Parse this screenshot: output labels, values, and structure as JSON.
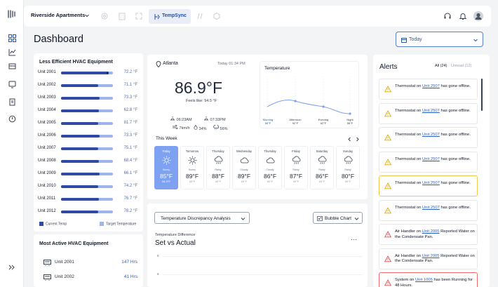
{
  "topbar": {
    "property": "Riverside Apartments",
    "active_tab": "TempSync"
  },
  "page": {
    "title": "Dashboard",
    "date_filter": "Today"
  },
  "less_efficient": {
    "title": "Less Efficient HVAC Equipment",
    "rows": [
      {
        "unit": "Unit 2001",
        "value": "72.2 °F",
        "progress": 0.92
      },
      {
        "unit": "Unit 2002",
        "value": "71.1 °F",
        "progress": 0.72
      },
      {
        "unit": "Unit 2003",
        "value": "73.3 °F",
        "progress": 0.74
      },
      {
        "unit": "Unit 2004",
        "value": "62.8 °F",
        "progress": 0.73
      },
      {
        "unit": "Unit 2005",
        "value": "81.7 °F",
        "progress": 0.72
      },
      {
        "unit": "Unit 2006",
        "value": "73.3 °F",
        "progress": 0.74
      },
      {
        "unit": "Unit 2007",
        "value": "75.1 °F",
        "progress": 0.72
      },
      {
        "unit": "Unit 2008",
        "value": "68.4 °F",
        "progress": 0.73
      },
      {
        "unit": "Unit 2009",
        "value": "66.1 °F",
        "progress": 0.74
      },
      {
        "unit": "Unit 2010",
        "value": "74.2 °F",
        "progress": 0.72
      },
      {
        "unit": "Unit 2011",
        "value": "76.7 °F",
        "progress": 0.73
      },
      {
        "unit": "Unit 2012",
        "value": "78.2 °F",
        "progress": 0.72
      }
    ],
    "legend_current": "Current Temp",
    "legend_target": "Target Temperature",
    "colors": {
      "current": "#2e4aa5",
      "target": "#9db5ec"
    }
  },
  "most_active": {
    "title": "Most Active HVAC Equipment",
    "rows": [
      {
        "unit": "Unit 2001",
        "value": "147 Hrs"
      },
      {
        "unit": "Unit 2002",
        "value": "41 Hrs"
      }
    ]
  },
  "weather": {
    "location": "Atlanta",
    "time": "Today 01:34 PM",
    "temperature": "86.9°F",
    "feels_like": "Feels like: 94.5 °F",
    "sunrise": "06:23AM",
    "sunset": "07:33PM",
    "wind": "7km/h",
    "humidity": "34%",
    "rain": "56%"
  },
  "temperature_chart": {
    "title": "Temperature",
    "periods": [
      {
        "name": "Morning",
        "temp": "56°F"
      },
      {
        "name": "Afternoon",
        "temp": "92°F"
      },
      {
        "name": "Evening",
        "temp": "62°F"
      },
      {
        "name": "Night",
        "temp": "56°F"
      }
    ]
  },
  "this_week": {
    "title": "This Week",
    "days": [
      {
        "name": "Today",
        "cond": "Sunny",
        "temp": "85°F",
        "low": "64.3°F"
      },
      {
        "name": "Tomorrow",
        "cond": "Sunny",
        "temp": "89°F",
        "low": "65°F"
      },
      {
        "name": "Thursday",
        "cond": "Rainy",
        "temp": "88°F",
        "low": "65°F"
      },
      {
        "name": "Wednesday",
        "cond": "Cloudy",
        "temp": "89°F",
        "low": "65°F"
      },
      {
        "name": "Thursday",
        "cond": "Cloudy",
        "temp": "86°F",
        "low": "65°F"
      },
      {
        "name": "Friday",
        "cond": "Rainy",
        "temp": "87°F",
        "low": "65°F"
      },
      {
        "name": "Saturday",
        "cond": "Rainy",
        "temp": "86°F",
        "low": "65°F"
      },
      {
        "name": "Sunday",
        "cond": "Rainy",
        "temp": "80°F",
        "low": "65°F"
      }
    ]
  },
  "discrepancy": {
    "dropdown": "Temperature Discrepancy Analysis",
    "chart_type": "Bubble Chart",
    "subtitle": "Temperature Difference",
    "title": "Set vs Actual",
    "axis_ticks": [
      "8",
      "6"
    ]
  },
  "alerts": {
    "title": "Alerts",
    "filter_all": "All (24)",
    "filter_unread": "Unread (12)",
    "items": [
      {
        "pre": "Thermostat on ",
        "link": "Unit 2507",
        "post": " has gone offline.",
        "level": "warning"
      },
      {
        "pre": "Thermostat on ",
        "link": "Unit 2507",
        "post": " has gone offline.",
        "level": "warning"
      },
      {
        "pre": "Thermostat on ",
        "link": "Unit 2507",
        "post": " has gone offline.",
        "level": "warning"
      },
      {
        "pre": "Thermostat on ",
        "link": "Unit 2507",
        "post": " has gone offline.",
        "level": "warning"
      },
      {
        "pre": "Thermostat on ",
        "link": "Unit 2507",
        "post": " has gone offline.",
        "level": "warning-highlight"
      },
      {
        "pre": "Thermostat on ",
        "link": "Unit 2507",
        "post": " has gone offline.",
        "level": "warning"
      },
      {
        "pre": "Air Handler on ",
        "link": "Unit 2005",
        "post": " Reported Water on the Condensate Pan.",
        "level": "error"
      },
      {
        "pre": "Air Handler on ",
        "link": "Unit 2005",
        "post": " Reported Water on the Condensate Pan.",
        "level": "error"
      },
      {
        "pre": "System on ",
        "link": "Unit 1005",
        "post": " has been Running for 48 Hours.",
        "level": "error-highlight"
      }
    ],
    "colors": {
      "warning": "#e0a800",
      "error": "#e14b4b",
      "link": "#2b5fc7"
    }
  }
}
